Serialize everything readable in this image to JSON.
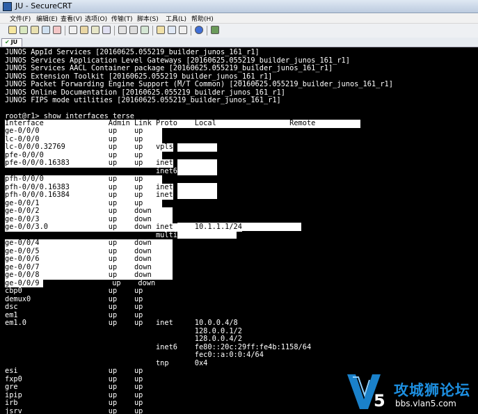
{
  "window": {
    "title": "JU - SecureCRT"
  },
  "menu": [
    "文件(F)",
    "编辑(E)",
    "查看(V)",
    "选项(O)",
    "传输(T)",
    "脚本(S)",
    "工具(L)",
    "帮助(H)"
  ],
  "toolbar_icons": [
    "connect-icon",
    "quick-connect-icon",
    "connect-tab-icon",
    "reconnect-icon",
    "disconnect-icon",
    "copy-icon",
    "paste-icon",
    "copy-paste-icon",
    "find-icon",
    "print-icon",
    "print-setup-icon",
    "print-selection-icon",
    "session-options-icon",
    "global-options-icon",
    "keymap-icon",
    "help-icon",
    "sftp-icon"
  ],
  "tab": {
    "label": "JU"
  },
  "terminal": {
    "colors": {
      "background": "#000000",
      "foreground": "#ffffff",
      "selection": "#ffffff"
    },
    "lines": [
      "JUNOS AppId Services [20160625.055219_builder_junos_161_r1]",
      "JUNOS Services Application Level Gateways [20160625.055219_builder_junos_161_r1]",
      "JUNOS Services AACL Container package [20160625.055219_builder_junos_161_r1]",
      "JUNOS Extension Toolkit [20160625.055219_builder_junos_161_r1]",
      "JUNOS Packet Forwarding Engine Support (M/T Common) [20160625.055219_builder_junos_161_r1]",
      "JUNOS Online Documentation [20160625.055219_builder_junos_161_r1]",
      "JUNOS FIPS mode utilities [20160625.055219_builder_junos_161_r1]",
      "",
      "root@r1> show interfaces terse",
      "Interface               Admin Link Proto    Local                 Remote",
      "ge-0/0/0                up    up",
      "lc-0/0/0                up    up",
      "lc-0/0/0.32769          up    up   vpls",
      "pfe-0/0/0               up    up",
      "pfe-0/0/0.16383         up    up   inet",
      "                                   inet6",
      "pfh-0/0/0               up    up",
      "pfh-0/0/0.16383         up    up   inet",
      "pfh-0/0/0.16384         up    up   inet",
      "ge-0/0/1                up    up",
      "ge-0/0/2                up    down",
      "ge-0/0/3                up    down",
      "ge-0/0/3.0              up    down inet     10.1.1.1/24",
      "                                   multiservice",
      "ge-0/0/4                up    down",
      "ge-0/0/5                up    down",
      "ge-0/0/6                up    down",
      "ge-0/0/7                up    down",
      "ge-0/0/8                up    down",
      "ge-0/0/9                up    down",
      "cbp0                    up    up",
      "demux0                  up    up",
      "dsc                     up    up",
      "em1                     up    up",
      "em1.0                   up    up   inet     10.0.0.4/8",
      "                                            128.0.0.1/2",
      "                                            128.0.0.4/2",
      "                                   inet6    fe80::20c:29ff:fe4b:1158/64",
      "                                            fec0::a:0:0:4/64",
      "                                   tnp      0x4",
      "esi                     up    up",
      "fxp0                    up    up",
      "gre                     up    up",
      "ipip                    up    up",
      "irb                     up    up",
      "jsrv                    up    up"
    ]
  },
  "watermark": {
    "text": "攻城狮论坛",
    "url": "bbs.vlan5.com",
    "logo_letters": "V5"
  }
}
